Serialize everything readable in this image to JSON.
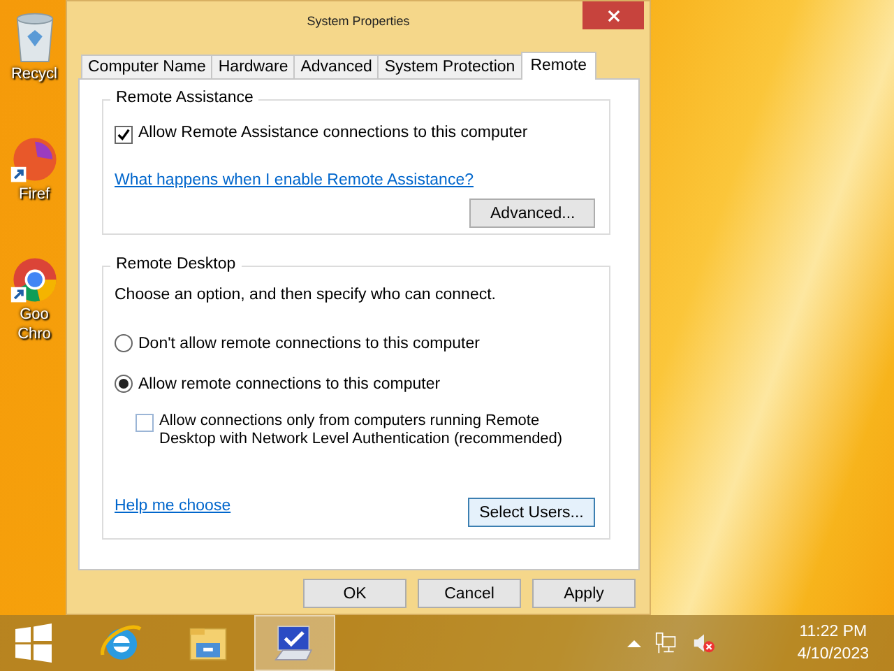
{
  "desktop_icons": [
    {
      "kind": "recycle",
      "lines": [
        "Recycl"
      ]
    },
    {
      "kind": "firefox",
      "lines": [
        "Firef"
      ]
    },
    {
      "kind": "chrome",
      "lines": [
        "Goo",
        "Chro"
      ]
    }
  ],
  "window": {
    "title": "System Properties"
  },
  "tabs": [
    {
      "label": "Computer Name",
      "selected": false
    },
    {
      "label": "Hardware",
      "selected": false
    },
    {
      "label": "Advanced",
      "selected": false
    },
    {
      "label": "System Protection",
      "selected": false
    },
    {
      "label": "Remote",
      "selected": true
    }
  ],
  "remote_assistance": {
    "title": "Remote Assistance",
    "checkbox": {
      "label": "Allow Remote Assistance connections to this computer",
      "checked": true
    },
    "link": "What happens when I enable Remote Assistance?",
    "button": "Advanced..."
  },
  "remote_desktop": {
    "title": "Remote Desktop",
    "intro": "Choose an option, and then specify who can connect.",
    "options": [
      {
        "label": "Don't allow remote connections to this computer",
        "selected": false
      },
      {
        "label": "Allow remote connections to this computer",
        "selected": true
      }
    ],
    "nla": {
      "label": "Allow connections only from computers running Remote Desktop with Network Level Authentication (recommended)",
      "checked": false
    },
    "link": "Help me choose",
    "button": "Select Users..."
  },
  "buttons": [
    "OK",
    "Cancel",
    "Apply"
  ],
  "taskbar": {
    "apps": [
      {
        "kind": "ie",
        "active": false
      },
      {
        "kind": "explorer",
        "active": false
      },
      {
        "kind": "sysprops",
        "active": true
      }
    ],
    "time": "11:22 PM",
    "date": "4/10/2023"
  }
}
